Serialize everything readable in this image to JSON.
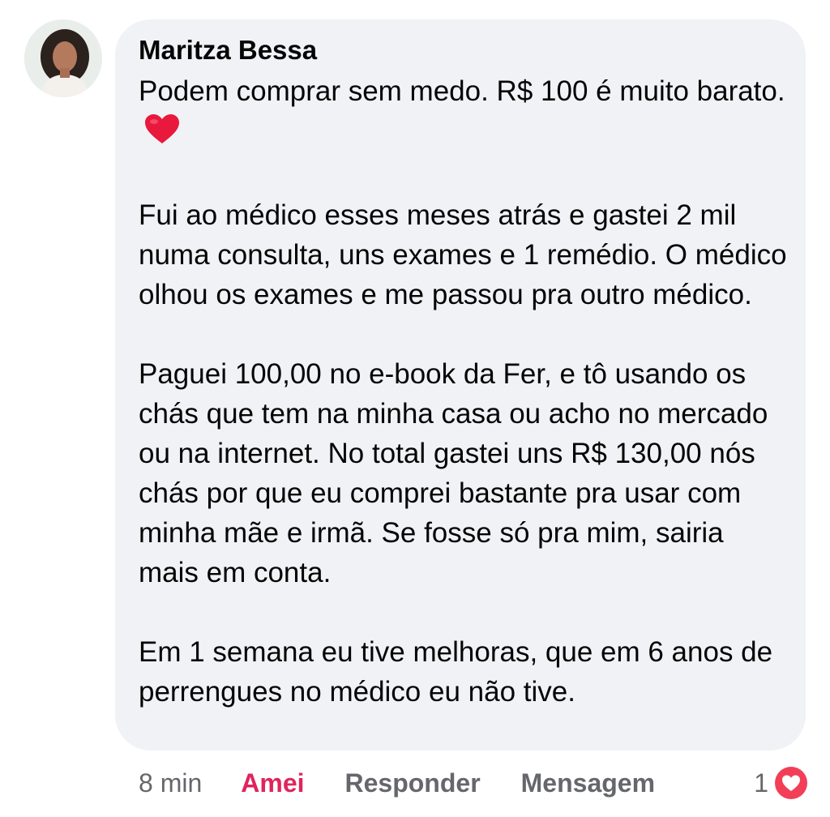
{
  "comment": {
    "author": "Maritza Bessa",
    "paragraphs": [
      "Podem comprar sem medo. R$ 100 é muito barato.",
      "Fui ao médico esses meses atrás e gastei 2 mil numa consulta, uns exames e 1 remédio. O médico olhou os exames e me passou pra outro médico.",
      "Paguei 100,00 no e-book da Fer, e tô usando os chás que tem na minha casa ou acho no mercado ou na internet. No total gastei uns R$ 130,00 nós chás por que eu comprei bastante pra usar com minha mãe e irmã. Se fosse só pra mim, sairia mais em conta.",
      "Em 1 semana eu tive melhoras, que em 6 anos de perrengues no médico eu não tive."
    ],
    "emoji": "heart-emoji"
  },
  "actions": {
    "time": "8 min",
    "love_label": "Amei",
    "reply_label": "Responder",
    "message_label": "Mensagem"
  },
  "reactions": {
    "count": "1",
    "icon": "love-reaction-icon"
  },
  "colors": {
    "bubble": "#f0f2f5",
    "love": "#e0245e",
    "muted": "#65676b",
    "text": "#050505"
  }
}
